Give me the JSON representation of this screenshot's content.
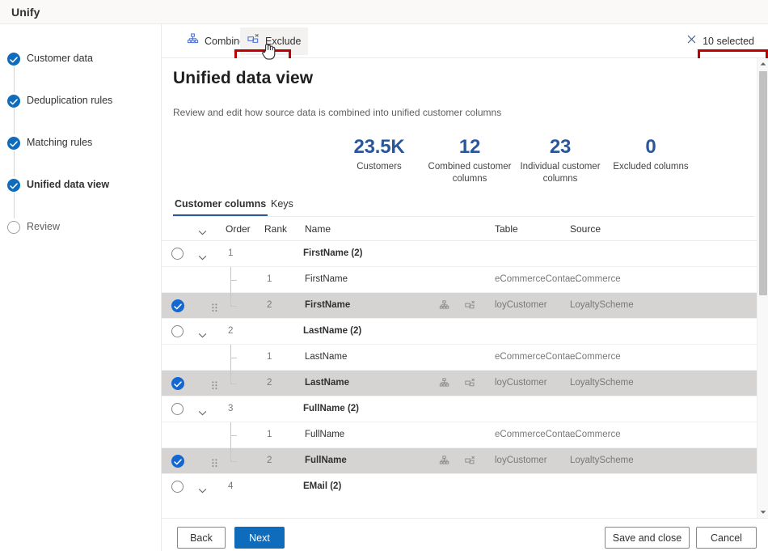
{
  "window": {
    "title": "Unify"
  },
  "wizard": {
    "steps": [
      {
        "label": "Customer data",
        "state": "done"
      },
      {
        "label": "Deduplication rules",
        "state": "done"
      },
      {
        "label": "Matching rules",
        "state": "done"
      },
      {
        "label": "Unified data view",
        "state": "current"
      },
      {
        "label": "Review",
        "state": "pending"
      }
    ]
  },
  "commandbar": {
    "combine_label": "Combine",
    "combine_icon": "combine-icon",
    "exclude_label": "Exclude",
    "exclude_icon": "exclude-icon",
    "selection_label": "10 selected",
    "selection_icon": "close-icon",
    "highlight_color": "#c00000"
  },
  "main": {
    "heading": "Unified data view",
    "subtitle": "Review and edit how source data is combined into unified customer columns",
    "stats": [
      {
        "value": "23.5K",
        "caption": "Customers"
      },
      {
        "value": "12",
        "caption": "Combined customer columns"
      },
      {
        "value": "23",
        "caption": "Individual customer columns"
      },
      {
        "value": "0",
        "caption": "Excluded columns"
      }
    ],
    "stat_color": "#2b579a",
    "tabs": [
      {
        "label": "Customer columns",
        "active": true
      },
      {
        "label": "Keys",
        "active": false
      }
    ]
  },
  "grid": {
    "headers": {
      "expand": "",
      "order": "Order",
      "rank": "Rank",
      "name": "Name",
      "table": "Table",
      "source": "Source"
    },
    "rows": [
      {
        "kind": "group",
        "order": "1",
        "name": "FirstName (2)",
        "selected": false
      },
      {
        "kind": "child",
        "rank": "1",
        "name": "FirstName",
        "table": "eCommerceConta...",
        "source": "eCommerce",
        "selected": false
      },
      {
        "kind": "child",
        "rank": "2",
        "name": "FirstName",
        "table": "loyCustomer",
        "source": "LoyaltyScheme",
        "selected": true
      },
      {
        "kind": "group",
        "order": "2",
        "name": "LastName (2)",
        "selected": false
      },
      {
        "kind": "child",
        "rank": "1",
        "name": "LastName",
        "table": "eCommerceConta...",
        "source": "eCommerce",
        "selected": false
      },
      {
        "kind": "child",
        "rank": "2",
        "name": "LastName",
        "table": "loyCustomer",
        "source": "LoyaltyScheme",
        "selected": true
      },
      {
        "kind": "group",
        "order": "3",
        "name": "FullName (2)",
        "selected": false
      },
      {
        "kind": "child",
        "rank": "1",
        "name": "FullName",
        "table": "eCommerceConta...",
        "source": "eCommerce",
        "selected": false
      },
      {
        "kind": "child",
        "rank": "2",
        "name": "FullName",
        "table": "loyCustomer",
        "source": "LoyaltyScheme",
        "selected": true
      },
      {
        "kind": "group",
        "order": "4",
        "name": "EMail (2)",
        "selected": false
      }
    ]
  },
  "footer": {
    "back_label": "Back",
    "next_label": "Next",
    "save_close_label": "Save and close",
    "cancel_label": "Cancel",
    "primary_color": "#0f6cbd"
  }
}
